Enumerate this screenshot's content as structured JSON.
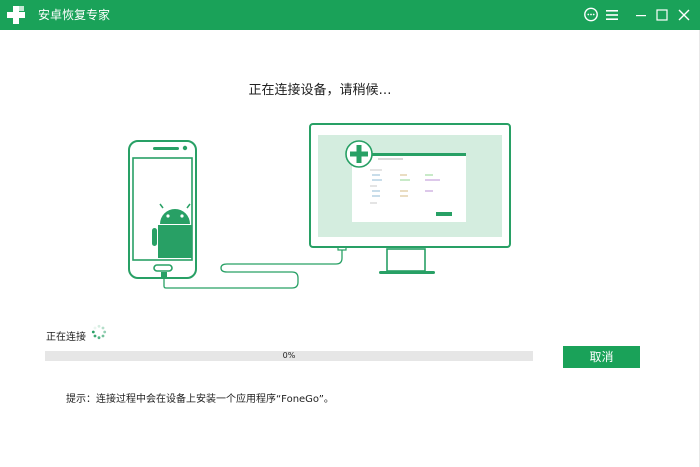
{
  "app": {
    "title": "安卓恢复专家",
    "logo_icon": "plus-cross-logo-icon",
    "controls": [
      "chat-icon",
      "menu-icon",
      "minimize-icon",
      "maximize-icon",
      "close-icon"
    ]
  },
  "main": {
    "status": "正在连接设备，请稍候…"
  },
  "illustration": {
    "phone_icon": "android-robot-icon",
    "monitor_logo_icon": "plus-cross-logo-icon"
  },
  "progress": {
    "label": "正在连接",
    "percent_text": "0%",
    "value": 0
  },
  "actions": {
    "cancel_label": "取消"
  },
  "tip": "提示：连接过程中会在设备上安装一个应用程序“FoneGo”。",
  "colors": {
    "brand": "#1aa259",
    "illustration_green": "#28a065",
    "progress_track": "#e6e6e6"
  }
}
